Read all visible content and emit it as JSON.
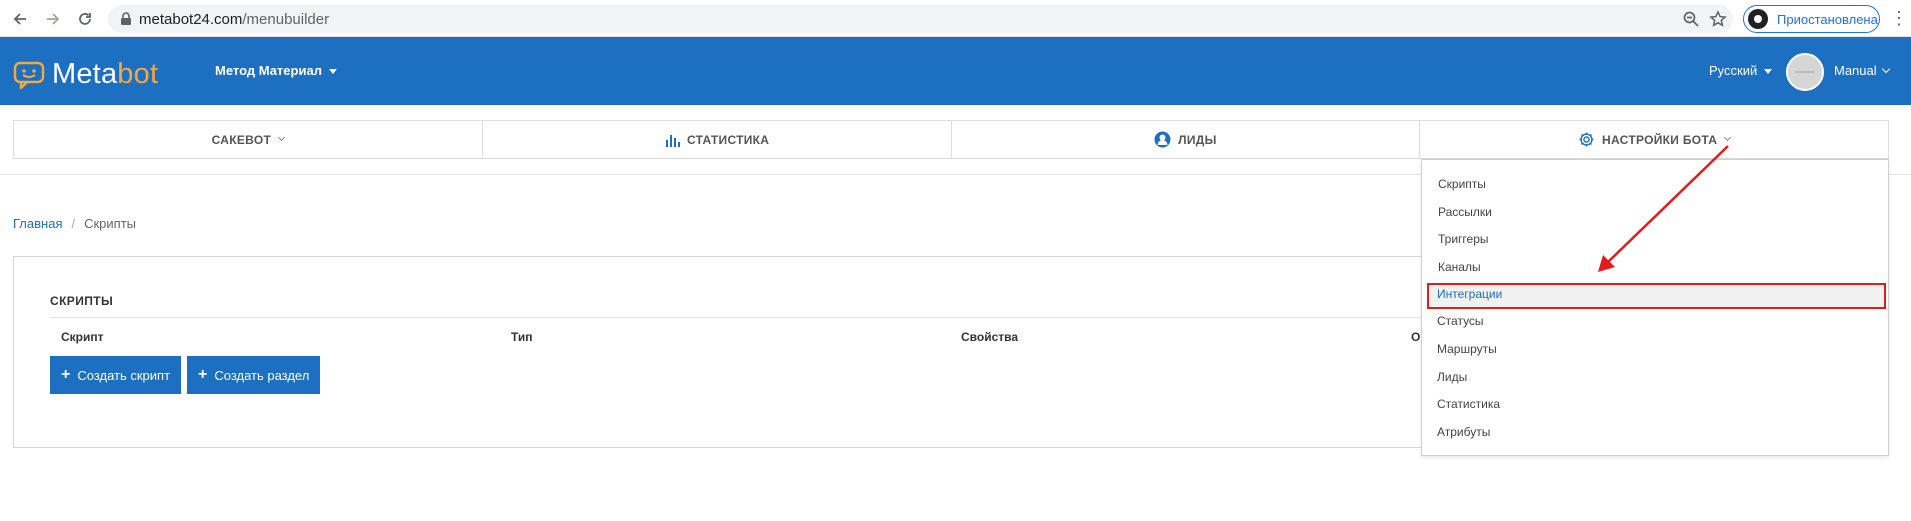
{
  "browser": {
    "url_host": "metabot24.com",
    "url_path": "/menubuilder",
    "profile_status": "Приостановлена",
    "icons": [
      "back-arrow-icon",
      "forward-arrow-icon",
      "reload-icon",
      "lock-icon",
      "zoom-icon",
      "star-icon",
      "kebab-menu-icon"
    ]
  },
  "header": {
    "logo_text_main": "Meta",
    "logo_text_accent": "bot",
    "bot_selector": "Метод Материал",
    "language": "Русский",
    "user": "Manual",
    "colors": {
      "bar": "#1c6fc1",
      "accent": "#f6a83a"
    }
  },
  "tabs": [
    {
      "label": "САКЕВОТ",
      "icon": ""
    },
    {
      "label": "СТАТИСТИКА",
      "icon": "bar-chart-icon"
    },
    {
      "label": "ЛИДЫ",
      "icon": "user-circle-icon"
    },
    {
      "label": "НАСТРОЙКИ БОТА",
      "icon": "gear-icon"
    }
  ],
  "breadcrumb": {
    "home": "Главная",
    "separator": "/",
    "current": "Скрипты"
  },
  "scripts_card": {
    "title": "СКРИПТЫ",
    "columns": [
      "Скрипт",
      "Тип",
      "Свойства",
      "О"
    ],
    "create_script": "Создать скрипт",
    "create_section": "Создать раздел"
  },
  "settings_menu": {
    "items": [
      "Скрипты",
      "Рассылки",
      "Триггеры",
      "Каналы",
      "Интеграции",
      "Статусы",
      "Маршруты",
      "Лиды",
      "Статистика",
      "Атрибуты"
    ],
    "highlighted": "Интеграции",
    "highlight_color": "#e11c1c"
  }
}
